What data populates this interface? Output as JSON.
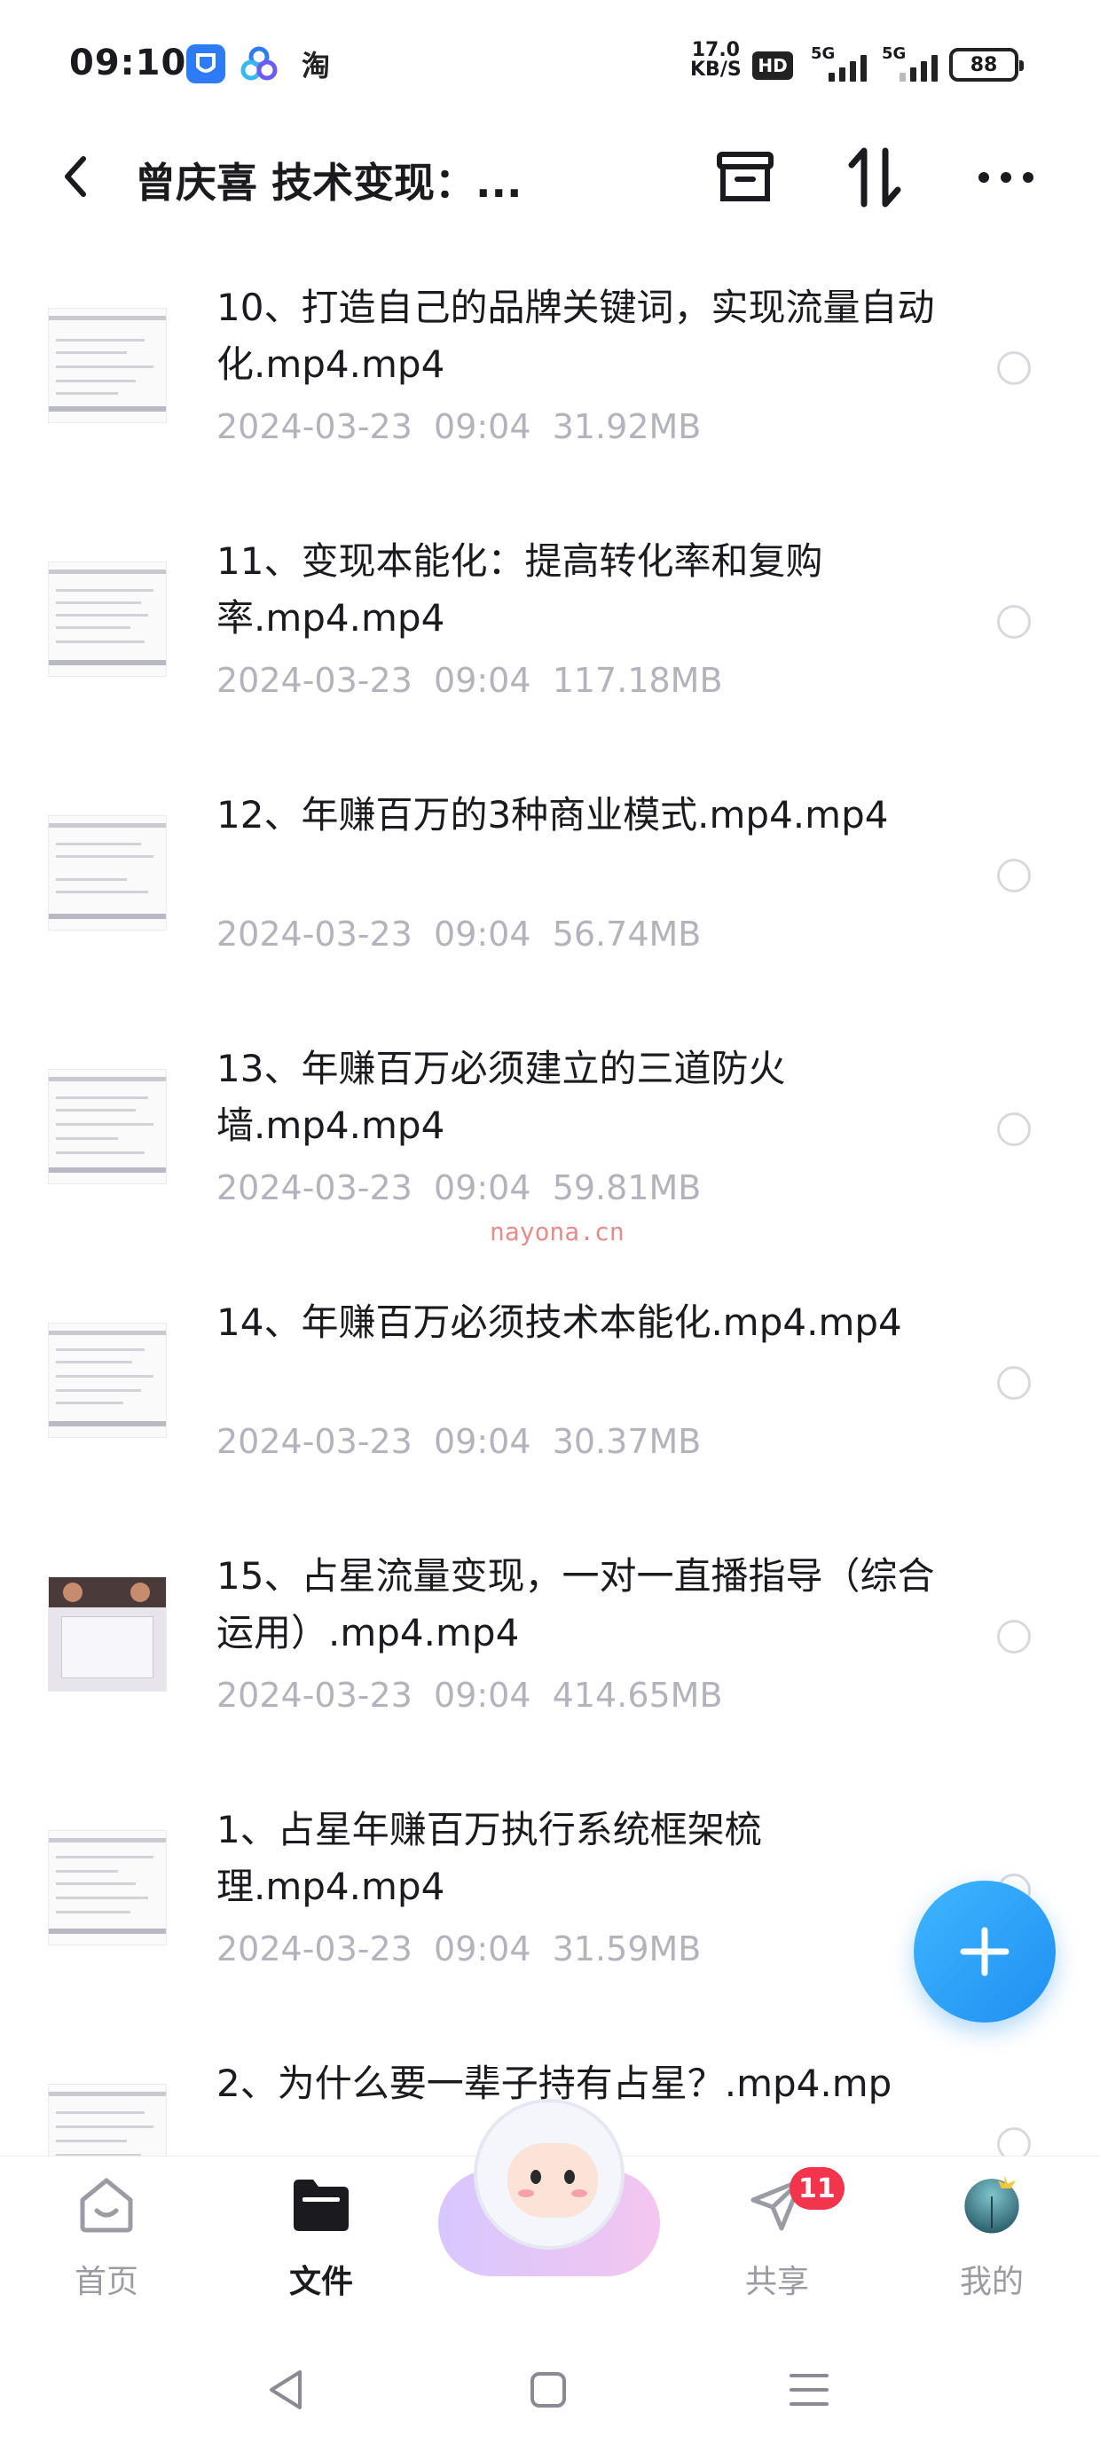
{
  "status_bar": {
    "time": "09:10",
    "app_icons": [
      "shield-app-icon",
      "cloud-app-icon",
      "taobao-icon"
    ],
    "taobao_label": "淘",
    "net_speed_value": "17.0",
    "net_speed_unit": "KB/S",
    "hd_label": "HD",
    "signal_1_label": "5G",
    "signal_2_label": "5G",
    "battery": "88"
  },
  "header": {
    "title": "曾庆喜 技术变现：..."
  },
  "files": [
    {
      "name": "10、打造自己的品牌关键词，实现流量自动化.mp4.mp4",
      "date": "2024-03-23",
      "time": "09:04",
      "size": "31.92MB",
      "thumb": "document"
    },
    {
      "name": "11、变现本能化：提高转化率和复购率.mp4.mp4",
      "date": "2024-03-23",
      "time": "09:04",
      "size": "117.18MB",
      "thumb": "document"
    },
    {
      "name": "12、年赚百万的3种商业模式.mp4.mp4",
      "date": "2024-03-23",
      "time": "09:04",
      "size": "56.74MB",
      "thumb": "document"
    },
    {
      "name": "13、年赚百万必须建立的三道防火墙.mp4.mp4",
      "date": "2024-03-23",
      "time": "09:04",
      "size": "59.81MB",
      "thumb": "document"
    },
    {
      "name": "14、年赚百万必须技术本能化.mp4.mp4",
      "date": "2024-03-23",
      "time": "09:04",
      "size": "30.37MB",
      "thumb": "document"
    },
    {
      "name": "15、占星流量变现，一对一直播指导（综合运用）.mp4.mp4",
      "date": "2024-03-23",
      "time": "09:04",
      "size": "414.65MB",
      "thumb": "video"
    },
    {
      "name": "1、占星年赚百万执行系统框架梳理.mp4.mp4",
      "date": "2024-03-23",
      "time": "09:04",
      "size": "31.59MB",
      "thumb": "document"
    },
    {
      "name": "2、为什么要一辈子持有占星？.mp4.mp",
      "date": "",
      "time": "",
      "size": "",
      "thumb": "document"
    }
  ],
  "watermark": "nayona.cn",
  "bottom_nav": {
    "home_label": "首页",
    "files_label": "文件",
    "share_label": "共享",
    "share_badge": "11",
    "me_label": "我的"
  },
  "colors": {
    "accent": "#1f8ff2",
    "badge": "#f2344d",
    "meta_text": "#b3b3bb",
    "primary_text": "#1b1b1f"
  }
}
